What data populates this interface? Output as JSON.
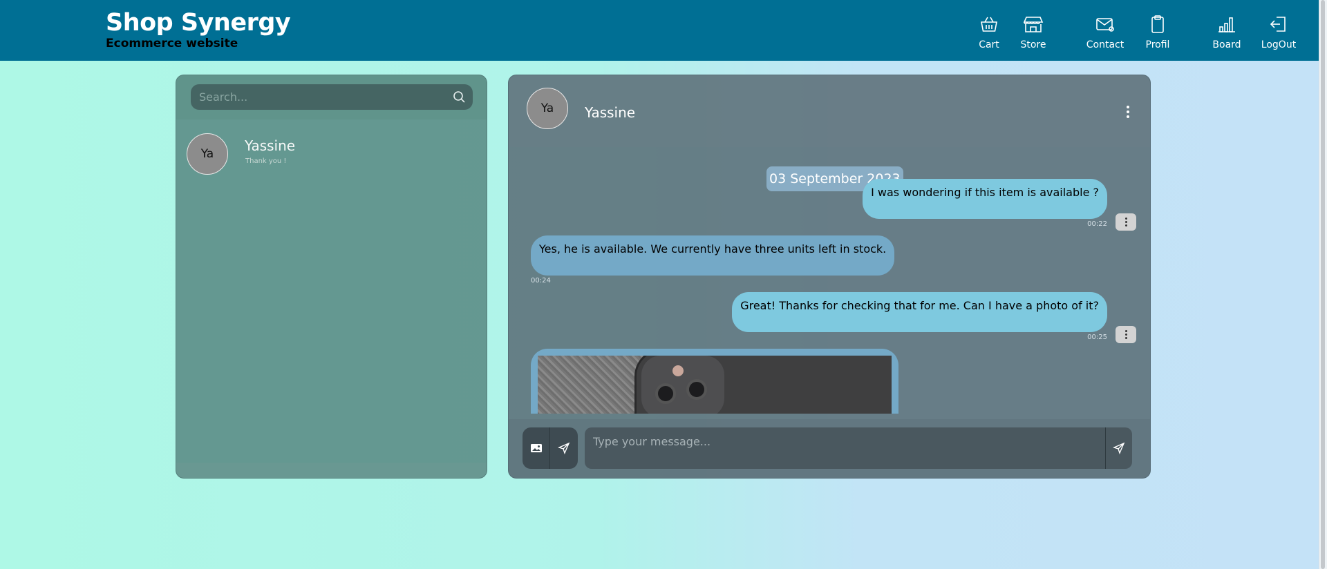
{
  "header": {
    "title": "Shop Synergy",
    "subtitle": "Ecommerce website",
    "nav": [
      {
        "label": "Cart",
        "icon": "basket-icon"
      },
      {
        "label": "Store",
        "icon": "store-icon"
      },
      {
        "label": "Contact",
        "icon": "envelope-at-icon"
      },
      {
        "label": "Profil",
        "icon": "clipboard-icon"
      },
      {
        "label": "Board",
        "icon": "bar-chart-icon"
      },
      {
        "label": "LogOut",
        "icon": "logout-icon"
      }
    ]
  },
  "sidebar": {
    "search_placeholder": "Search...",
    "conversations": [
      {
        "initials": "Ya",
        "name": "Yassine",
        "last_message": "Thank you !"
      }
    ]
  },
  "chat": {
    "contact_initials": "Ya",
    "contact_name": "Yassine",
    "date_label": "03 September 2023",
    "messages": [
      {
        "direction": "outgoing",
        "text": "I was wondering if this item is available ?",
        "time": "00:22"
      },
      {
        "direction": "incoming",
        "text": "Yes, he is available. We currently have three units left in stock.",
        "time": "00:24"
      },
      {
        "direction": "outgoing",
        "text": "Great! Thanks for checking that for me. Can I have a photo of it?",
        "time": "00:25"
      },
      {
        "direction": "incoming",
        "type": "image",
        "content": "photo-of-phone"
      }
    ],
    "composer_placeholder": "Type your message..."
  },
  "colors": {
    "header_bg": "#006f94",
    "outgoing_bubble": "#7ec9df",
    "incoming_bubble": "#74a9c7"
  }
}
